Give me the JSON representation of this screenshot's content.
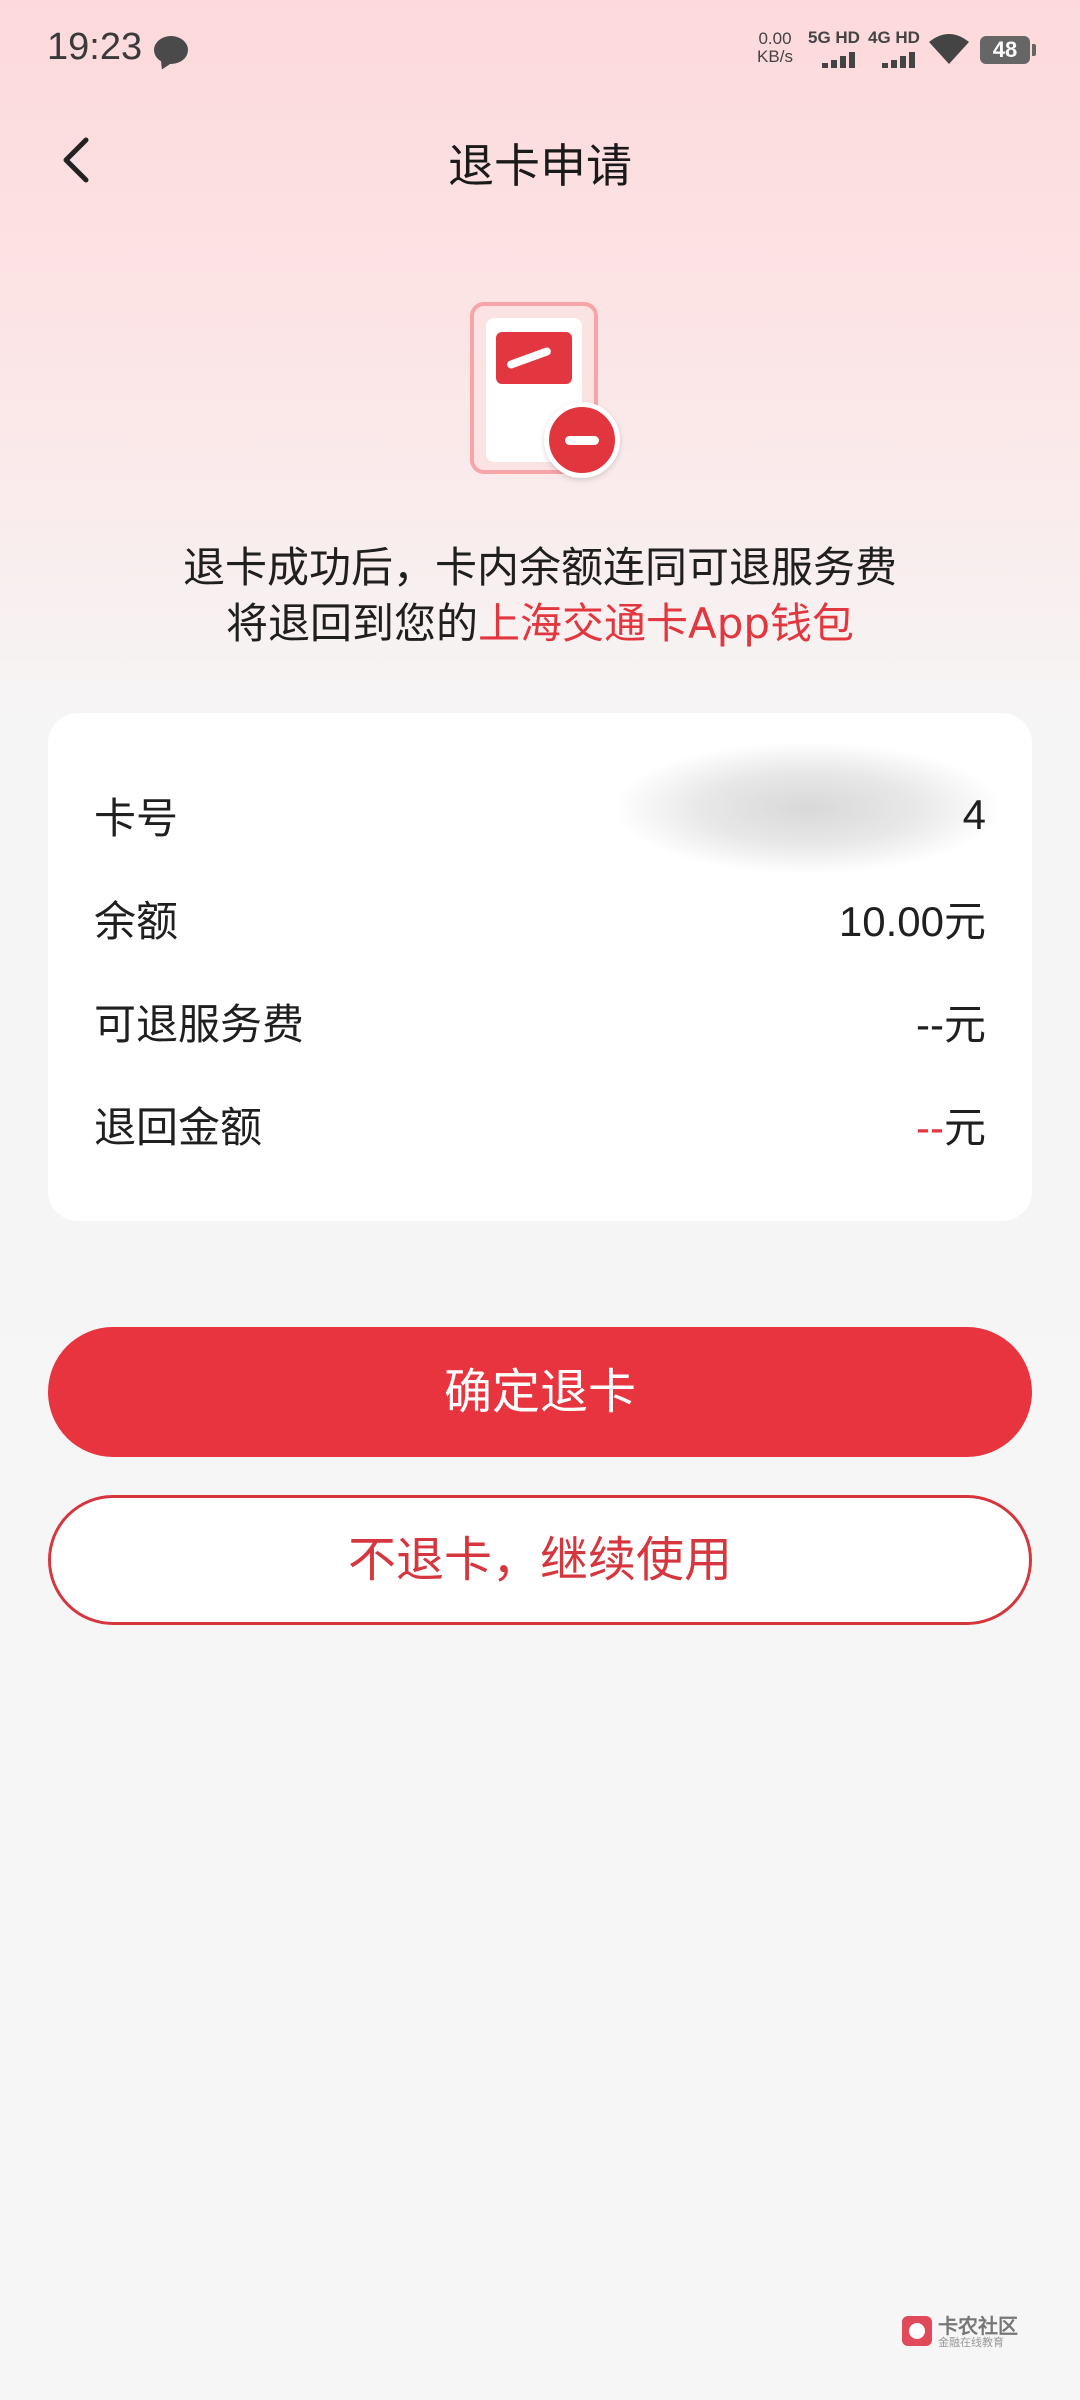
{
  "status_bar": {
    "time": "19:23",
    "net_speed_value": "0.00",
    "net_speed_unit": "KB/s",
    "sim1": "5G HD",
    "sim2": "4G HD",
    "battery": "48",
    "icons": [
      "chat-bubble-icon",
      "signal-bars-icon",
      "wifi-icon",
      "battery-icon"
    ]
  },
  "header": {
    "title": "退卡申请",
    "back_icon": "chevron-left-icon"
  },
  "illustration": {
    "icon": "card-remove-icon"
  },
  "description": {
    "line1": "退卡成功后，卡内余额连同可退服务费",
    "line2_prefix": "将退回到您的",
    "line2_highlight": "上海交通卡App钱包"
  },
  "info": {
    "card_no_label": "卡号",
    "card_no_value": "4",
    "balance_label": "余额",
    "balance_value": "10.00元",
    "service_fee_label": "可退服务费",
    "service_fee_value": "--元",
    "refund_label": "退回金额",
    "refund_dash": "--",
    "refund_unit": "元"
  },
  "actions": {
    "confirm_label": "确定退卡",
    "cancel_label": "不退卡，继续使用"
  },
  "watermark": {
    "text": "卡农社区",
    "sub": "金融在线教育"
  },
  "colors": {
    "accent": "#e8343e",
    "highlight": "#e3373f",
    "background": "#f6f6f6"
  }
}
